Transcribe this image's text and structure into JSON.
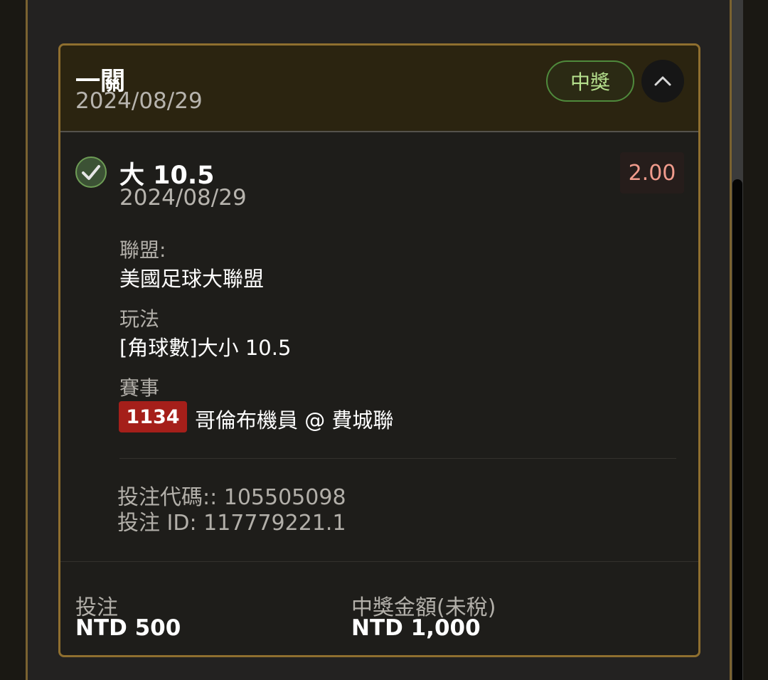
{
  "card": {
    "bet_type": "一關",
    "date": "2024/08/29",
    "status_badge": "中獎",
    "selection": {
      "title": "大 10.5",
      "date": "2024/08/29",
      "odds": "2.00"
    },
    "league_label": "聯盟:",
    "league_value": "美國足球大聯盟",
    "market_label": "玩法",
    "market_value": "[角球數]大小 10.5",
    "event_label": "賽事",
    "event_id": "1134",
    "event_name": "哥倫布機員 @ 費城聯",
    "bet_code_line": "投注代碼:: 105505098",
    "bet_id_line": "投注 ID: 117779221.1",
    "stake_label": "投注",
    "stake_value": "NTD 500",
    "payout_label": "中獎金額(未稅)",
    "payout_value": "NTD 1,000"
  },
  "icons": [
    "check-circle-icon",
    "chevron-up-icon"
  ],
  "colors": {
    "accent_gold": "#8f6f2f",
    "win_green": "#b5e08d",
    "odds_red": "#f09b8c",
    "match_id_red": "#a51f1a"
  }
}
